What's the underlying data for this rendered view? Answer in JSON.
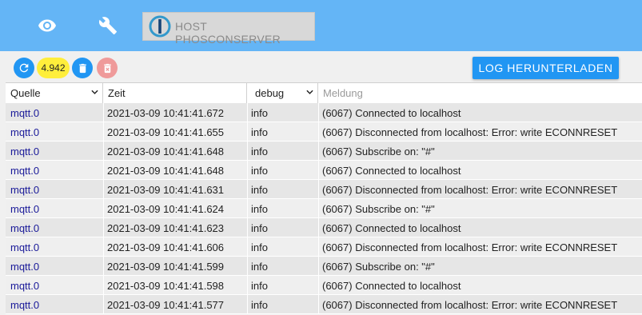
{
  "nav": {
    "host_label": "HOST PHOSCONSERVER"
  },
  "toolbar": {
    "log_count": "4.942",
    "download_label": "LOG HERUNTERLADEN"
  },
  "columns": {
    "source_filter": "Quelle",
    "time": "Zeit",
    "severity_filter": "debug",
    "message_placeholder": "Meldung"
  },
  "rows": [
    {
      "source": "mqtt.0",
      "time": "2021-03-09 10:41:41.672",
      "severity": "info",
      "message": "(6067) Connected to localhost"
    },
    {
      "source": "mqtt.0",
      "time": "2021-03-09 10:41:41.655",
      "severity": "info",
      "message": "(6067) Disconnected from localhost: Error: write ECONNRESET"
    },
    {
      "source": "mqtt.0",
      "time": "2021-03-09 10:41:41.648",
      "severity": "info",
      "message": "(6067) Subscribe on: \"#\""
    },
    {
      "source": "mqtt.0",
      "time": "2021-03-09 10:41:41.648",
      "severity": "info",
      "message": "(6067) Connected to localhost"
    },
    {
      "source": "mqtt.0",
      "time": "2021-03-09 10:41:41.631",
      "severity": "info",
      "message": "(6067) Disconnected from localhost: Error: write ECONNRESET"
    },
    {
      "source": "mqtt.0",
      "time": "2021-03-09 10:41:41.624",
      "severity": "info",
      "message": "(6067) Subscribe on: \"#\""
    },
    {
      "source": "mqtt.0",
      "time": "2021-03-09 10:41:41.623",
      "severity": "info",
      "message": "(6067) Connected to localhost"
    },
    {
      "source": "mqtt.0",
      "time": "2021-03-09 10:41:41.606",
      "severity": "info",
      "message": "(6067) Disconnected from localhost: Error: write ECONNRESET"
    },
    {
      "source": "mqtt.0",
      "time": "2021-03-09 10:41:41.599",
      "severity": "info",
      "message": "(6067) Subscribe on: \"#\""
    },
    {
      "source": "mqtt.0",
      "time": "2021-03-09 10:41:41.598",
      "severity": "info",
      "message": "(6067) Connected to localhost"
    },
    {
      "source": "mqtt.0",
      "time": "2021-03-09 10:41:41.577",
      "severity": "info",
      "message": "(6067) Disconnected from localhost: Error: write ECONNRESET"
    }
  ],
  "icons": [
    "eye-icon",
    "wrench-icon",
    "iobroker-logo-icon",
    "refresh-icon",
    "delete-icon",
    "delete-all-icon",
    "chevron-down-icon"
  ],
  "colors": {
    "topbar": "#64b5f6",
    "primary": "#2196f3",
    "badge": "#ffee3b",
    "danger_disabled": "#ef9a9a",
    "source_text": "#1a1a99"
  }
}
